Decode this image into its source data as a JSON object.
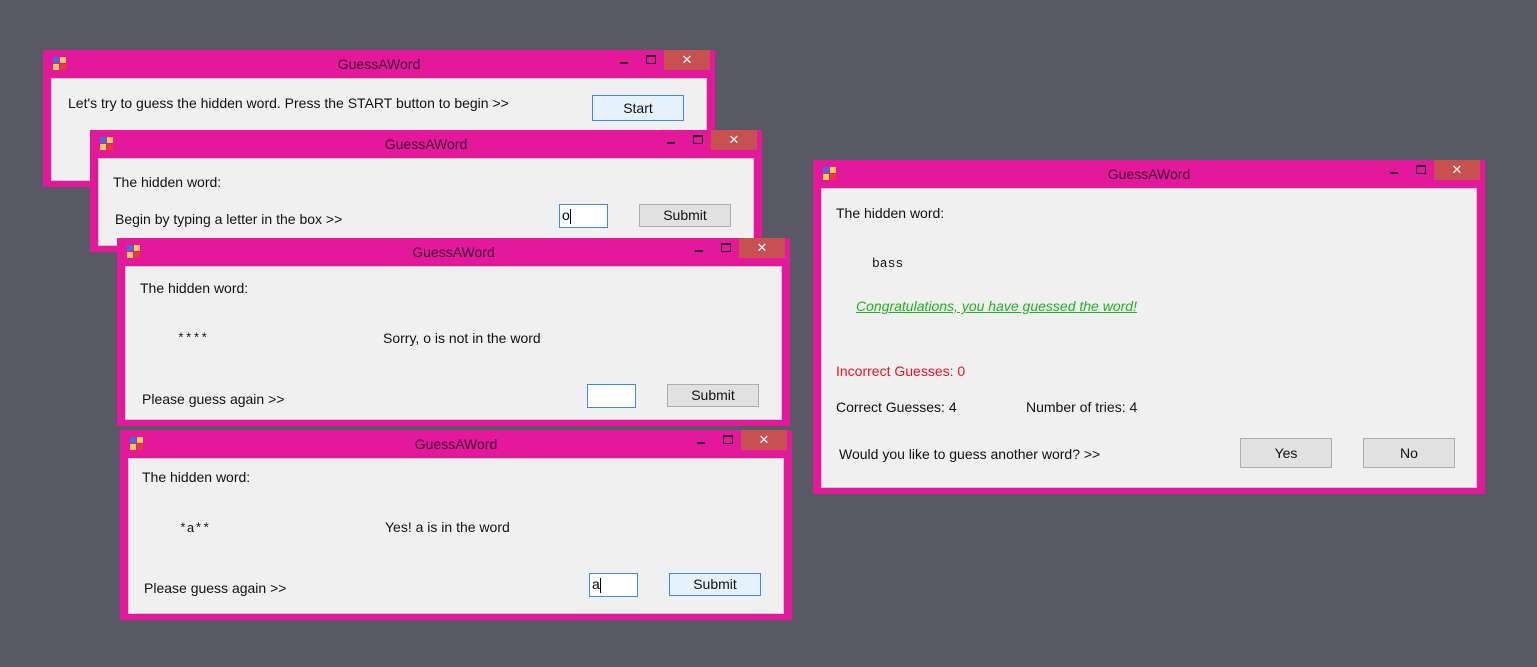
{
  "app_title": "GuessAWord",
  "controls": {
    "minimize": "–",
    "maximize": "□",
    "close": "✕"
  },
  "window1": {
    "prompt": "Let's try to guess the hidden word. Press the START button to begin >>",
    "start_label": "Start"
  },
  "window2": {
    "hidden_word_label": "The hidden word:",
    "instruction": "Begin by typing a letter in the box >>",
    "input_value": "o",
    "submit_label": "Submit"
  },
  "window3": {
    "hidden_word_label": "The hidden word:",
    "masked_word": "****",
    "feedback": "Sorry, o is not in the word",
    "instruction": "Please guess again >>",
    "input_value": "",
    "submit_label": "Submit"
  },
  "window4": {
    "hidden_word_label": "The hidden word:",
    "masked_word": "*a**",
    "feedback": "Yes! a is in the word",
    "instruction": "Please guess again >>",
    "input_value": "a",
    "submit_label": "Submit"
  },
  "window5": {
    "hidden_word_label": "The hidden word:",
    "word": "bass",
    "congrats": "Congratulations, you have guessed the word!",
    "incorrect_guesses": "Incorrect Guesses: 0",
    "correct_guesses": "Correct Guesses: 4",
    "number_of_tries": "Number of tries: 4",
    "play_again_prompt": "Would you like to guess another word? >>",
    "yes_label": "Yes",
    "no_label": "No"
  },
  "colors": {
    "title_bar": "#e4189b",
    "close_button": "#c75050",
    "desktop": "#595865",
    "congrats_text": "#1fb21f",
    "incorrect_text": "#e81123"
  }
}
